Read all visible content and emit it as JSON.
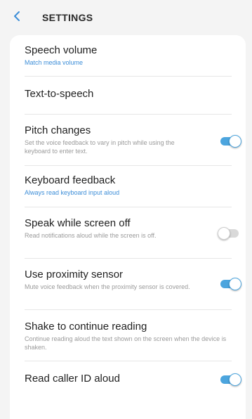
{
  "header": {
    "title": "SETTINGS",
    "back_icon": "chevron-left-icon"
  },
  "colors": {
    "accent": "#4ca5de",
    "link": "#3d8ed8",
    "background": "#f4f4f4"
  },
  "items": [
    {
      "title": "Speech volume",
      "subtitle": "Match media volume"
    },
    {
      "title": "Text-to-speech"
    },
    {
      "title": "Pitch changes",
      "subtitle": "Set the voice feedback to vary in pitch while using the keyboard to enter text.",
      "toggle": true
    },
    {
      "title": "Keyboard feedback",
      "subtitle": "Always read keyboard input aloud"
    },
    {
      "title": "Speak while screen off",
      "subtitle": "Read notifications aloud while the screen is off.",
      "toggle": false
    },
    {
      "title": "Use proximity sensor",
      "subtitle": "Mute voice feedback when the proximity sensor is covered.",
      "toggle": true
    },
    {
      "title": "Shake to continue reading",
      "subtitle": "Continue reading aloud the text shown on the screen when the device is shaken."
    },
    {
      "title": "Read caller ID aloud",
      "toggle": true
    }
  ]
}
